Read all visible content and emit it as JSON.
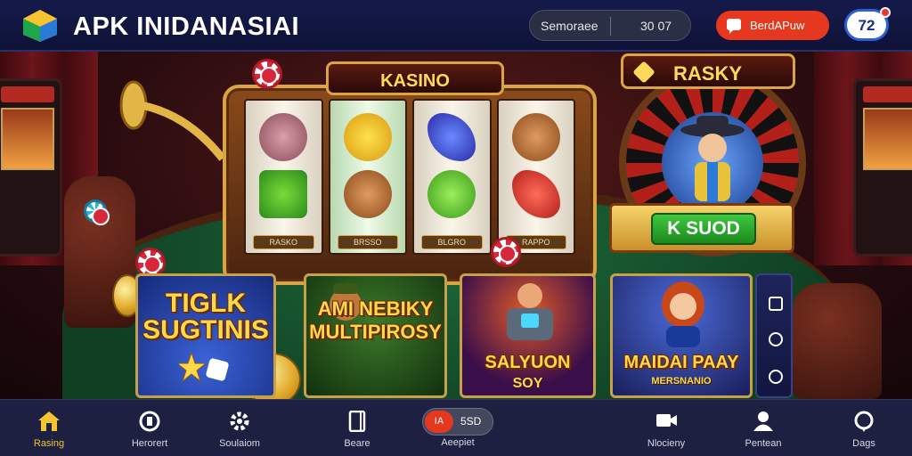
{
  "header": {
    "title": "APK INIDANASIAI",
    "search_label": "Semoraee",
    "search_value": "30 07",
    "deposit_label": "BerdAPuw",
    "level": "72"
  },
  "scene": {
    "slot_title": "KASINO",
    "reel_captions": [
      "RASKO",
      "BRSSO",
      "BLGRO",
      "RAPPO"
    ],
    "right_sign": "RASKY",
    "price_button": "K SUOD"
  },
  "cards": [
    {
      "title": "TIGLK SUGTINIS",
      "subtitle": ""
    },
    {
      "title": "AMI NEBIKY MULTIPIROSY",
      "subtitle": ""
    },
    {
      "title": "SALYUON",
      "subtitle": "SOY"
    },
    {
      "title": "MAIDAI PAAY",
      "subtitle": "MERSNANIO"
    }
  ],
  "bottom_nav": {
    "items": [
      {
        "label": "Rasing",
        "icon": "home-icon",
        "active": true
      },
      {
        "label": "Herorert",
        "icon": "bookmark-badge-icon",
        "active": false
      },
      {
        "label": "Soulaiom",
        "icon": "gear-icon",
        "active": false
      },
      {
        "label": "Beare",
        "icon": "page-icon",
        "active": false
      },
      {
        "label": "Nlocieny",
        "icon": "video-icon",
        "active": false
      },
      {
        "label": "Pentean",
        "icon": "user-icon",
        "active": false
      },
      {
        "label": "Dags",
        "icon": "chat-bubble-icon",
        "active": false
      }
    ],
    "center_toggle_left": "IA",
    "center_toggle_right": "5SD",
    "center_label": "Aeepiet"
  },
  "colors": {
    "accent_red": "#e6381f",
    "active_yellow": "#f4c531",
    "navy": "#151a4a",
    "gold": "#d9a441"
  }
}
